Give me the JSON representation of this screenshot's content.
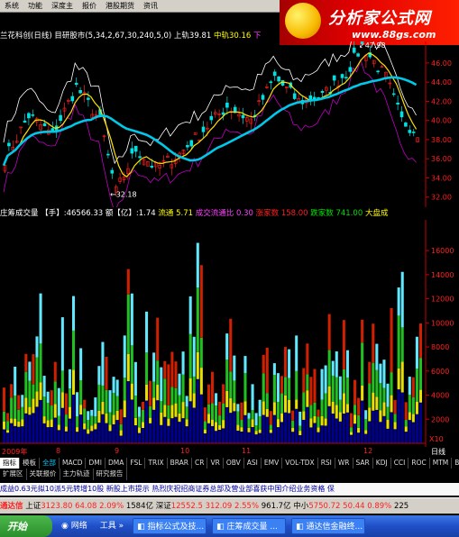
{
  "menu": {
    "items": [
      "系统",
      "功能",
      "深度主",
      "报价",
      "港股期货",
      "资讯"
    ],
    "icon_box": "▼"
  },
  "info": {
    "stock_name": "兰花科创(日线)",
    "formula": "目研股市(5,34,2,67,30,240,5,0)",
    "upper_label": "上轨",
    "upper_val": "39.81",
    "mid_label": "中轨",
    "mid_val": "30.16",
    "lower_label": "下"
  },
  "brand": {
    "logo": "分析家公式网",
    "url": "www.88gs.com"
  },
  "price_axis": {
    "ticks": [
      "46.00",
      "44.00",
      "42.00",
      "40.00",
      "38.00",
      "36.00",
      "34.00",
      "32.00"
    ],
    "high_label": "47.98",
    "low_label": "32.18"
  },
  "volume_header": {
    "title": "庄筹成交量",
    "unit_label": "【手】",
    "hand_val": ":46566.33",
    "amount_label": "额【亿】",
    "amount_val": ":1.74",
    "circ_label": "流通",
    "circ_val": "5.71",
    "turnover_label": "成交流通比",
    "turnover_val": "0.30",
    "up_label": "涨家数",
    "up_val": "158.00",
    "down_label": "跌家数",
    "down_val": "741.00",
    "market_label": "大盘成"
  },
  "volume_axis": {
    "ticks": [
      "16000",
      "14000",
      "12000",
      "10000",
      "8000",
      "6000",
      "4000",
      "2000"
    ],
    "unit": "X10"
  },
  "date_axis": {
    "labels": [
      "2009年",
      "8",
      "9",
      "10",
      "11",
      "12"
    ],
    "end_label": "日线"
  },
  "tabs_row1": [
    "指标",
    "模板",
    "全部",
    "MACD",
    "DMI",
    "DMA",
    "FSL",
    "TRIX",
    "BRAR",
    "CR",
    "VR",
    "OBV",
    "ASI",
    "EMV",
    "VOL-TDX",
    "RSI",
    "WR",
    "SAR",
    "KDJ",
    "CCI",
    "ROC",
    "MTM",
    "BOLL"
  ],
  "tabs_row2": [
    "扩展区",
    "关联报价",
    "主力轨迹",
    "研究报告"
  ],
  "ticker": "成益0.63元拟10派5元转增10股     新股上市提示     热烈庆祝招商证券总部及营业部喜获中国介绍业务资格     保",
  "status": {
    "app": "通达信",
    "sh_label": "上证",
    "sh_val": "3123.80",
    "sh_chg": "64.08",
    "sh_pct": "2.09%",
    "sh_amt": "1584亿",
    "sz_label": "深证",
    "sz_val": "12552.5",
    "sz_chg": "312.09",
    "sz_pct": "2.55%",
    "sz_amt": "961.7亿",
    "sm_label": "中小",
    "sm_val": "5750.72",
    "sm_chg": "50.44",
    "sm_pct": "0.89%",
    "sm_amt": "225"
  },
  "taskbar": {
    "start": "开始",
    "items": [
      "网络",
      "工具",
      "指标公式及技...",
      "庄筹成交量 ...",
      "通达信金融终..."
    ]
  },
  "colors": {
    "price_ma": "#00c8e8",
    "upper_band": "#ffffff",
    "lower_band": "#c000c0",
    "candle_up": "#ff2020",
    "candle_down": "#00e0e0",
    "vol_red": "#d02000",
    "vol_cyan": "#60e8ff",
    "vol_green": "#20c020",
    "vol_yellow": "#e8e000",
    "vol_navy": "#000090"
  }
}
